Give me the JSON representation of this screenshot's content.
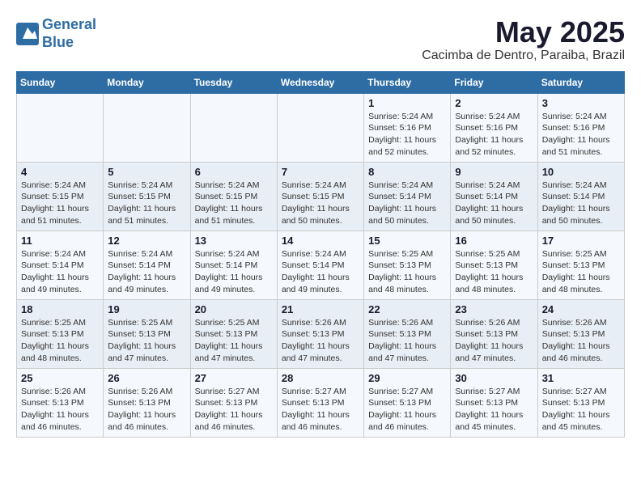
{
  "header": {
    "logo_line1": "General",
    "logo_line2": "Blue",
    "month": "May 2025",
    "location": "Cacimba de Dentro, Paraiba, Brazil"
  },
  "days_of_week": [
    "Sunday",
    "Monday",
    "Tuesday",
    "Wednesday",
    "Thursday",
    "Friday",
    "Saturday"
  ],
  "weeks": [
    [
      {
        "day": "",
        "info": ""
      },
      {
        "day": "",
        "info": ""
      },
      {
        "day": "",
        "info": ""
      },
      {
        "day": "",
        "info": ""
      },
      {
        "day": "1",
        "info": "Sunrise: 5:24 AM\nSunset: 5:16 PM\nDaylight: 11 hours\nand 52 minutes."
      },
      {
        "day": "2",
        "info": "Sunrise: 5:24 AM\nSunset: 5:16 PM\nDaylight: 11 hours\nand 52 minutes."
      },
      {
        "day": "3",
        "info": "Sunrise: 5:24 AM\nSunset: 5:16 PM\nDaylight: 11 hours\nand 51 minutes."
      }
    ],
    [
      {
        "day": "4",
        "info": "Sunrise: 5:24 AM\nSunset: 5:15 PM\nDaylight: 11 hours\nand 51 minutes."
      },
      {
        "day": "5",
        "info": "Sunrise: 5:24 AM\nSunset: 5:15 PM\nDaylight: 11 hours\nand 51 minutes."
      },
      {
        "day": "6",
        "info": "Sunrise: 5:24 AM\nSunset: 5:15 PM\nDaylight: 11 hours\nand 51 minutes."
      },
      {
        "day": "7",
        "info": "Sunrise: 5:24 AM\nSunset: 5:15 PM\nDaylight: 11 hours\nand 50 minutes."
      },
      {
        "day": "8",
        "info": "Sunrise: 5:24 AM\nSunset: 5:14 PM\nDaylight: 11 hours\nand 50 minutes."
      },
      {
        "day": "9",
        "info": "Sunrise: 5:24 AM\nSunset: 5:14 PM\nDaylight: 11 hours\nand 50 minutes."
      },
      {
        "day": "10",
        "info": "Sunrise: 5:24 AM\nSunset: 5:14 PM\nDaylight: 11 hours\nand 50 minutes."
      }
    ],
    [
      {
        "day": "11",
        "info": "Sunrise: 5:24 AM\nSunset: 5:14 PM\nDaylight: 11 hours\nand 49 minutes."
      },
      {
        "day": "12",
        "info": "Sunrise: 5:24 AM\nSunset: 5:14 PM\nDaylight: 11 hours\nand 49 minutes."
      },
      {
        "day": "13",
        "info": "Sunrise: 5:24 AM\nSunset: 5:14 PM\nDaylight: 11 hours\nand 49 minutes."
      },
      {
        "day": "14",
        "info": "Sunrise: 5:24 AM\nSunset: 5:14 PM\nDaylight: 11 hours\nand 49 minutes."
      },
      {
        "day": "15",
        "info": "Sunrise: 5:25 AM\nSunset: 5:13 PM\nDaylight: 11 hours\nand 48 minutes."
      },
      {
        "day": "16",
        "info": "Sunrise: 5:25 AM\nSunset: 5:13 PM\nDaylight: 11 hours\nand 48 minutes."
      },
      {
        "day": "17",
        "info": "Sunrise: 5:25 AM\nSunset: 5:13 PM\nDaylight: 11 hours\nand 48 minutes."
      }
    ],
    [
      {
        "day": "18",
        "info": "Sunrise: 5:25 AM\nSunset: 5:13 PM\nDaylight: 11 hours\nand 48 minutes."
      },
      {
        "day": "19",
        "info": "Sunrise: 5:25 AM\nSunset: 5:13 PM\nDaylight: 11 hours\nand 47 minutes."
      },
      {
        "day": "20",
        "info": "Sunrise: 5:25 AM\nSunset: 5:13 PM\nDaylight: 11 hours\nand 47 minutes."
      },
      {
        "day": "21",
        "info": "Sunrise: 5:26 AM\nSunset: 5:13 PM\nDaylight: 11 hours\nand 47 minutes."
      },
      {
        "day": "22",
        "info": "Sunrise: 5:26 AM\nSunset: 5:13 PM\nDaylight: 11 hours\nand 47 minutes."
      },
      {
        "day": "23",
        "info": "Sunrise: 5:26 AM\nSunset: 5:13 PM\nDaylight: 11 hours\nand 47 minutes."
      },
      {
        "day": "24",
        "info": "Sunrise: 5:26 AM\nSunset: 5:13 PM\nDaylight: 11 hours\nand 46 minutes."
      }
    ],
    [
      {
        "day": "25",
        "info": "Sunrise: 5:26 AM\nSunset: 5:13 PM\nDaylight: 11 hours\nand 46 minutes."
      },
      {
        "day": "26",
        "info": "Sunrise: 5:26 AM\nSunset: 5:13 PM\nDaylight: 11 hours\nand 46 minutes."
      },
      {
        "day": "27",
        "info": "Sunrise: 5:27 AM\nSunset: 5:13 PM\nDaylight: 11 hours\nand 46 minutes."
      },
      {
        "day": "28",
        "info": "Sunrise: 5:27 AM\nSunset: 5:13 PM\nDaylight: 11 hours\nand 46 minutes."
      },
      {
        "day": "29",
        "info": "Sunrise: 5:27 AM\nSunset: 5:13 PM\nDaylight: 11 hours\nand 46 minutes."
      },
      {
        "day": "30",
        "info": "Sunrise: 5:27 AM\nSunset: 5:13 PM\nDaylight: 11 hours\nand 45 minutes."
      },
      {
        "day": "31",
        "info": "Sunrise: 5:27 AM\nSunset: 5:13 PM\nDaylight: 11 hours\nand 45 minutes."
      }
    ]
  ]
}
